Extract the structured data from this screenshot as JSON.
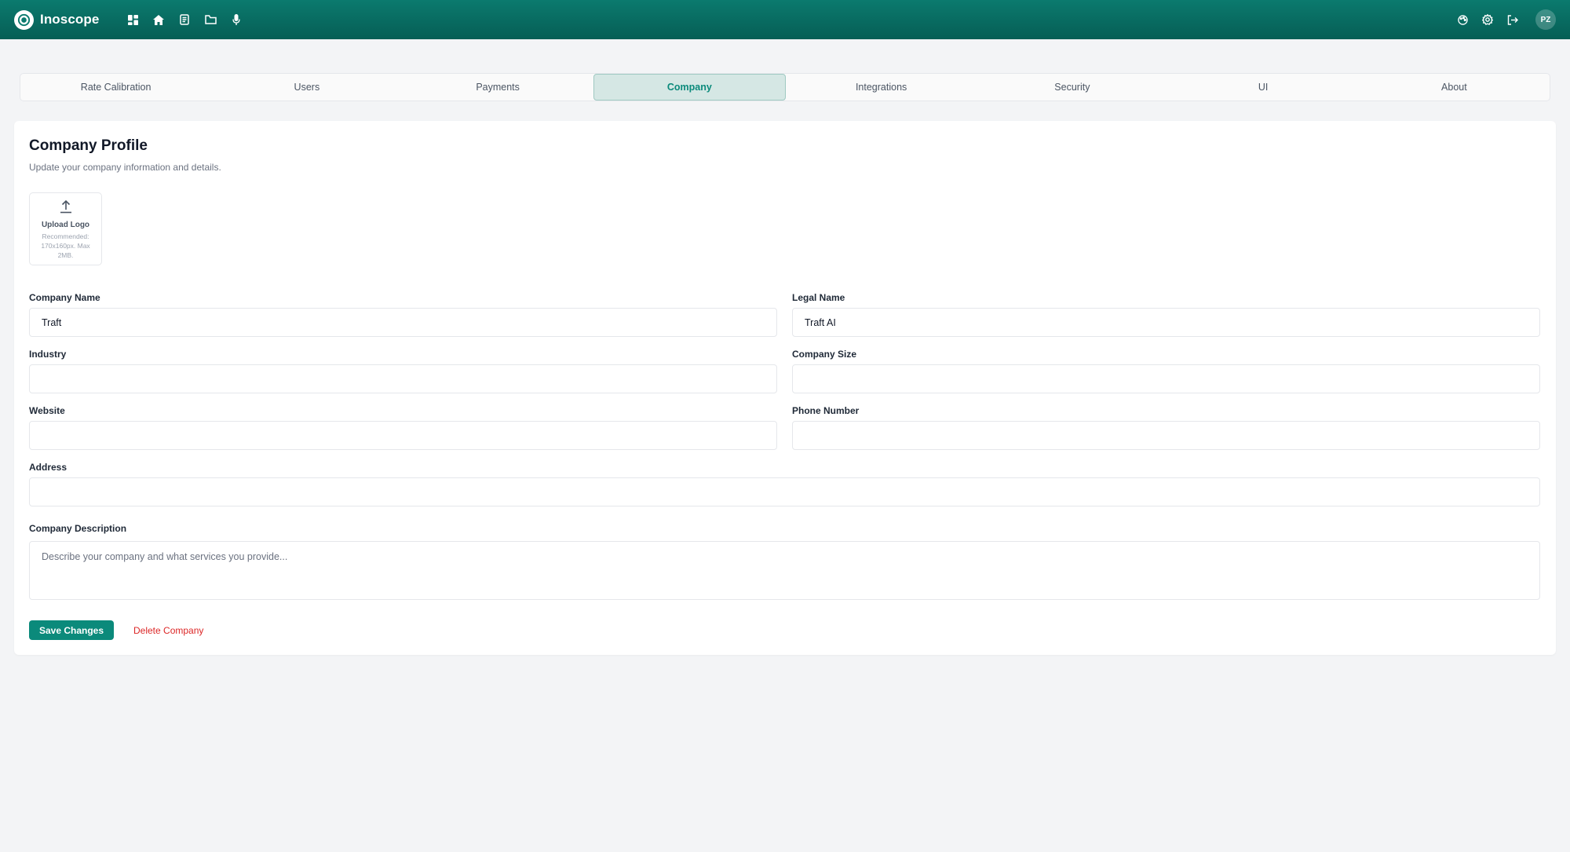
{
  "app": {
    "name": "Inoscope",
    "nav_icons": [
      "dashboard-icon",
      "home-icon",
      "document-icon",
      "folder-icon",
      "microphone-icon"
    ],
    "right_icons": [
      "palette-icon",
      "gear-icon",
      "logout-icon"
    ],
    "user_initials": "PZ"
  },
  "tabs": [
    {
      "label": "Rate Calibration",
      "active": false
    },
    {
      "label": "Users",
      "active": false
    },
    {
      "label": "Payments",
      "active": false
    },
    {
      "label": "Company",
      "active": true
    },
    {
      "label": "Integrations",
      "active": false
    },
    {
      "label": "Security",
      "active": false
    },
    {
      "label": "UI",
      "active": false
    },
    {
      "label": "About",
      "active": false
    }
  ],
  "profile": {
    "title": "Company Profile",
    "subtitle": "Update your company information and details.",
    "upload_label": "Upload Logo",
    "upload_hint": "Recommended: 170x160px. Max 2MB."
  },
  "fields": {
    "company_name": {
      "label": "Company Name",
      "value": "Traft"
    },
    "legal_name": {
      "label": "Legal Name",
      "value": "Traft AI"
    },
    "industry": {
      "label": "Industry",
      "value": ""
    },
    "company_size": {
      "label": "Company Size",
      "value": ""
    },
    "website": {
      "label": "Website",
      "value": ""
    },
    "phone": {
      "label": "Phone Number",
      "value": ""
    },
    "address": {
      "label": "Address",
      "value": ""
    },
    "description": {
      "label": "Company Description",
      "value": "",
      "placeholder": "Describe your company and what services you provide..."
    }
  },
  "actions": {
    "save_label": "Save Changes",
    "delete_label": "Delete Company"
  },
  "colors": {
    "brand": "#0b8a7b",
    "header": "#065e55",
    "danger": "#dc2626"
  }
}
